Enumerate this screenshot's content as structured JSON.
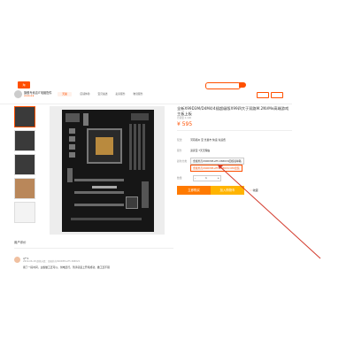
{
  "header": {
    "logo": "淘",
    "search_placeholder": "",
    "search_button": ""
  },
  "shop": {
    "name": "旗舰专卖店IT电脑配件",
    "sub": "★★★★★",
    "badges": [
      "天猫",
      "店铺体验",
      "宝贝描述",
      "卖家服务",
      "物流服务"
    ]
  },
  "product": {
    "title": "全新X99D3M/D4M4/4插超级版X99四大于双路M.2NVMe高端游戏主板上板",
    "subtitle": "月销量 2,100",
    "price": "¥ 595",
    "labels": {
      "shipping": "配送",
      "service": "服务",
      "color": "颜色分类",
      "qty": "数量"
    },
    "shipping_value": "河南郑州 至 长葛市 快递 免运费",
    "service_value": "退货宝  7天无理由",
    "options": [
      "金属外壳X99D3M+E5 2680V4四核插单路",
      "金属外壳X99D3M+E5 2680V4 CPU套装"
    ],
    "qty_value": "1",
    "buy_label": "立即购买",
    "cart_label": "加入购物车",
    "fav_label": "收藏"
  },
  "reviews": {
    "heading": "用户评价",
    "user": "q**1",
    "meta": "2019-06-18 颜色分类：金属外壳X99D3M+E5 2680V4",
    "text": "用了一段时间，主板做工还可以，供电还行，到手就装上开机成功，做工还不错"
  },
  "colors": {
    "accent": "#ff5000",
    "buy": "#ff7a00",
    "cart": "#ffb400",
    "arrow": "#d33a2c"
  },
  "icons": {
    "fav": "heart-icon",
    "search": "search-icon"
  }
}
